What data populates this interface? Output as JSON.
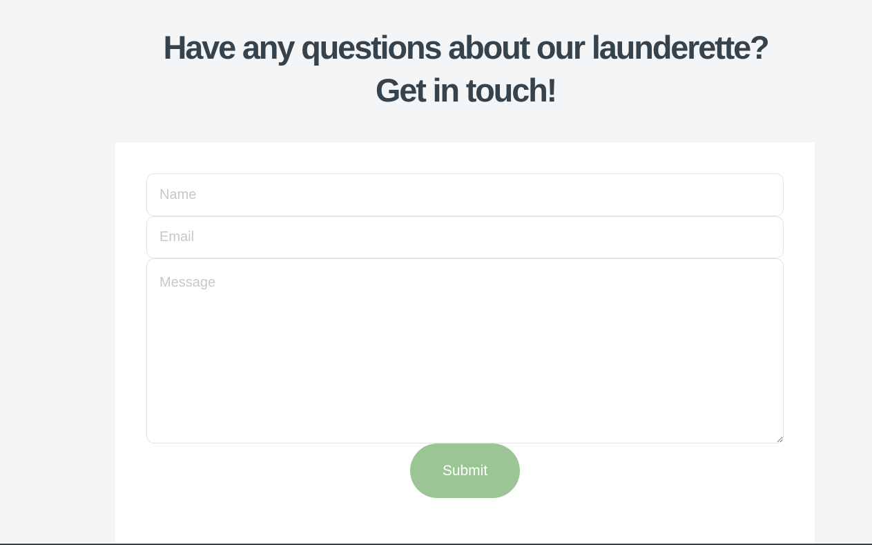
{
  "contact": {
    "heading_line1": "Have any questions about our launderette?",
    "heading_line2": "Get in touch!",
    "name_placeholder": "Name",
    "email_placeholder": "Email",
    "message_placeholder": "Message",
    "submit_label": "Submit"
  },
  "colors": {
    "page_background": "#f3f5f7",
    "heading_text": "#36434c",
    "card_background": "#ffffff",
    "submit_button": "#9bc594",
    "placeholder_text": "#c4c9cd"
  }
}
